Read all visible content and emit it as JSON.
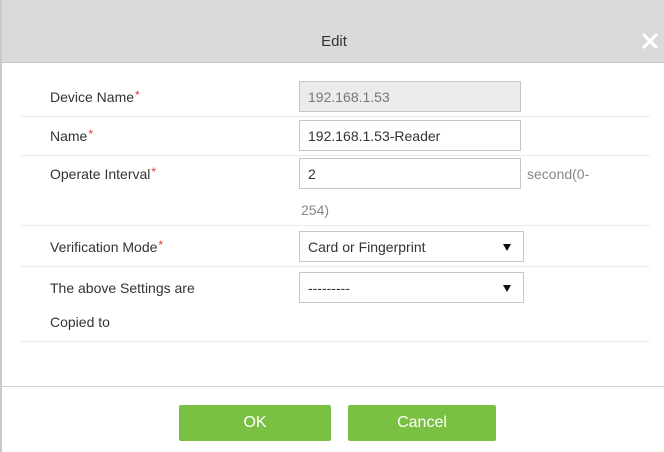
{
  "dialog": {
    "title": "Edit",
    "close_glyph": "✕"
  },
  "form": {
    "device_name": {
      "label": "Device Name",
      "required_mark": "*",
      "value": "192.168.1.53"
    },
    "name": {
      "label": "Name",
      "required_mark": "*",
      "value": "192.168.1.53-Reader"
    },
    "operate_interval": {
      "label": "Operate Interval",
      "required_mark": "*",
      "value": "2",
      "unit_line1": "second(0-",
      "unit_line2": "254)"
    },
    "verification_mode": {
      "label": "Verification Mode",
      "required_mark": "*",
      "value": "Card or Fingerprint"
    },
    "copy_settings": {
      "label_line1": "The above Settings are",
      "label_line2": "Copied to",
      "value": "---------"
    }
  },
  "buttons": {
    "ok": "OK",
    "cancel": "Cancel"
  },
  "colors": {
    "button_green": "#7ac143",
    "required_red": "#e23333",
    "titlebar": "#d9d9d9"
  },
  "icons": {
    "close": "close-icon",
    "dropdown": "dropdown-arrow-icon"
  }
}
